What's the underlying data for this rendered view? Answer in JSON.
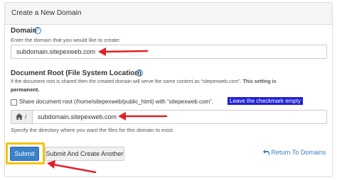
{
  "panel": {
    "title": "Create a New Domain"
  },
  "domain": {
    "label": "Domain",
    "help_icon": "question-circle-icon",
    "description": "Enter the domain that you would like to create:",
    "value": "subdomain.sitepexweb.com"
  },
  "document_root": {
    "label": "Document Root (File System Location)",
    "help_icon": "question-circle-icon",
    "description_line1": "If the document root is shared then the created domain will serve the same content as “sitepexweb.com”.",
    "description_bold_a": "This setting is",
    "description_bold_b": "permanent.",
    "checkbox_label": "Share document root (/home/sitepexweb/public_html) with “sitepexweb.com”.",
    "checkbox_checked": false,
    "callout": "Leave the checkmark empty",
    "callout_color": "#1f1fd6",
    "prefix_icon": "home-icon",
    "prefix_text": "/",
    "value": "subdomain.sitepexweb.com",
    "hint": "Specify the directory where you want the files for this domain to exist."
  },
  "actions": {
    "submit": "Submit",
    "submit_and_create": "Submit And Create Another",
    "return_icon": "return-arrow-icon",
    "return": "Return To Domains"
  },
  "colors": {
    "accent": "#3b82c8",
    "annotation_arrow": "#e0202a",
    "focus_highlight": "#f2c500"
  }
}
